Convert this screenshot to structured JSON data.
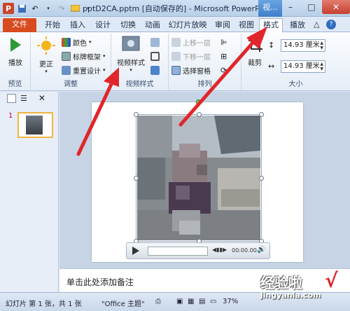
{
  "titlebar": {
    "title": "pptD2CA.pptm [自动保存的] - Microsoft PowerP...",
    "context_tab": "视...",
    "min": "–",
    "max": "□",
    "close": "✕"
  },
  "tabs": [
    {
      "label": "文件"
    },
    {
      "label": "开始"
    },
    {
      "label": "插入"
    },
    {
      "label": "设计"
    },
    {
      "label": "切换"
    },
    {
      "label": "动画"
    },
    {
      "label": "幻灯片放映"
    },
    {
      "label": "审阅"
    },
    {
      "label": "视图"
    },
    {
      "label": "格式"
    },
    {
      "label": "播放"
    }
  ],
  "ribbon": {
    "preview": {
      "play": "播放",
      "group": "预览"
    },
    "adjust": {
      "correct": "更正",
      "color": "颜色",
      "poster": "标牌框架",
      "reset": "重置设计",
      "group": "调整"
    },
    "styles": {
      "video_styles": "视频样式",
      "group": "视频样式"
    },
    "arrange": {
      "bring_forward": "上移一层",
      "send_backward": "下移一层",
      "selection_pane": "选择窗格",
      "group": "排列"
    },
    "size": {
      "crop": "裁剪",
      "height": "14.93 厘米",
      "width": "14.93 厘米",
      "group": "大小"
    }
  },
  "left_panel": {
    "slide_number": "1"
  },
  "notes": {
    "placeholder": "单击此处添加备注"
  },
  "player": {
    "time": "00:00.00"
  },
  "status": {
    "slide": "幻灯片 第 1 张，共 1 张",
    "theme": "\"Office 主题\"",
    "zoom": "37%"
  },
  "watermark": {
    "text": "经验啦",
    "check": "√",
    "url": "jingyanla.com"
  },
  "colors": {
    "file_tab": "#d84b1f",
    "arrow": "#e0262a",
    "selection_handle": "#7fc244"
  }
}
